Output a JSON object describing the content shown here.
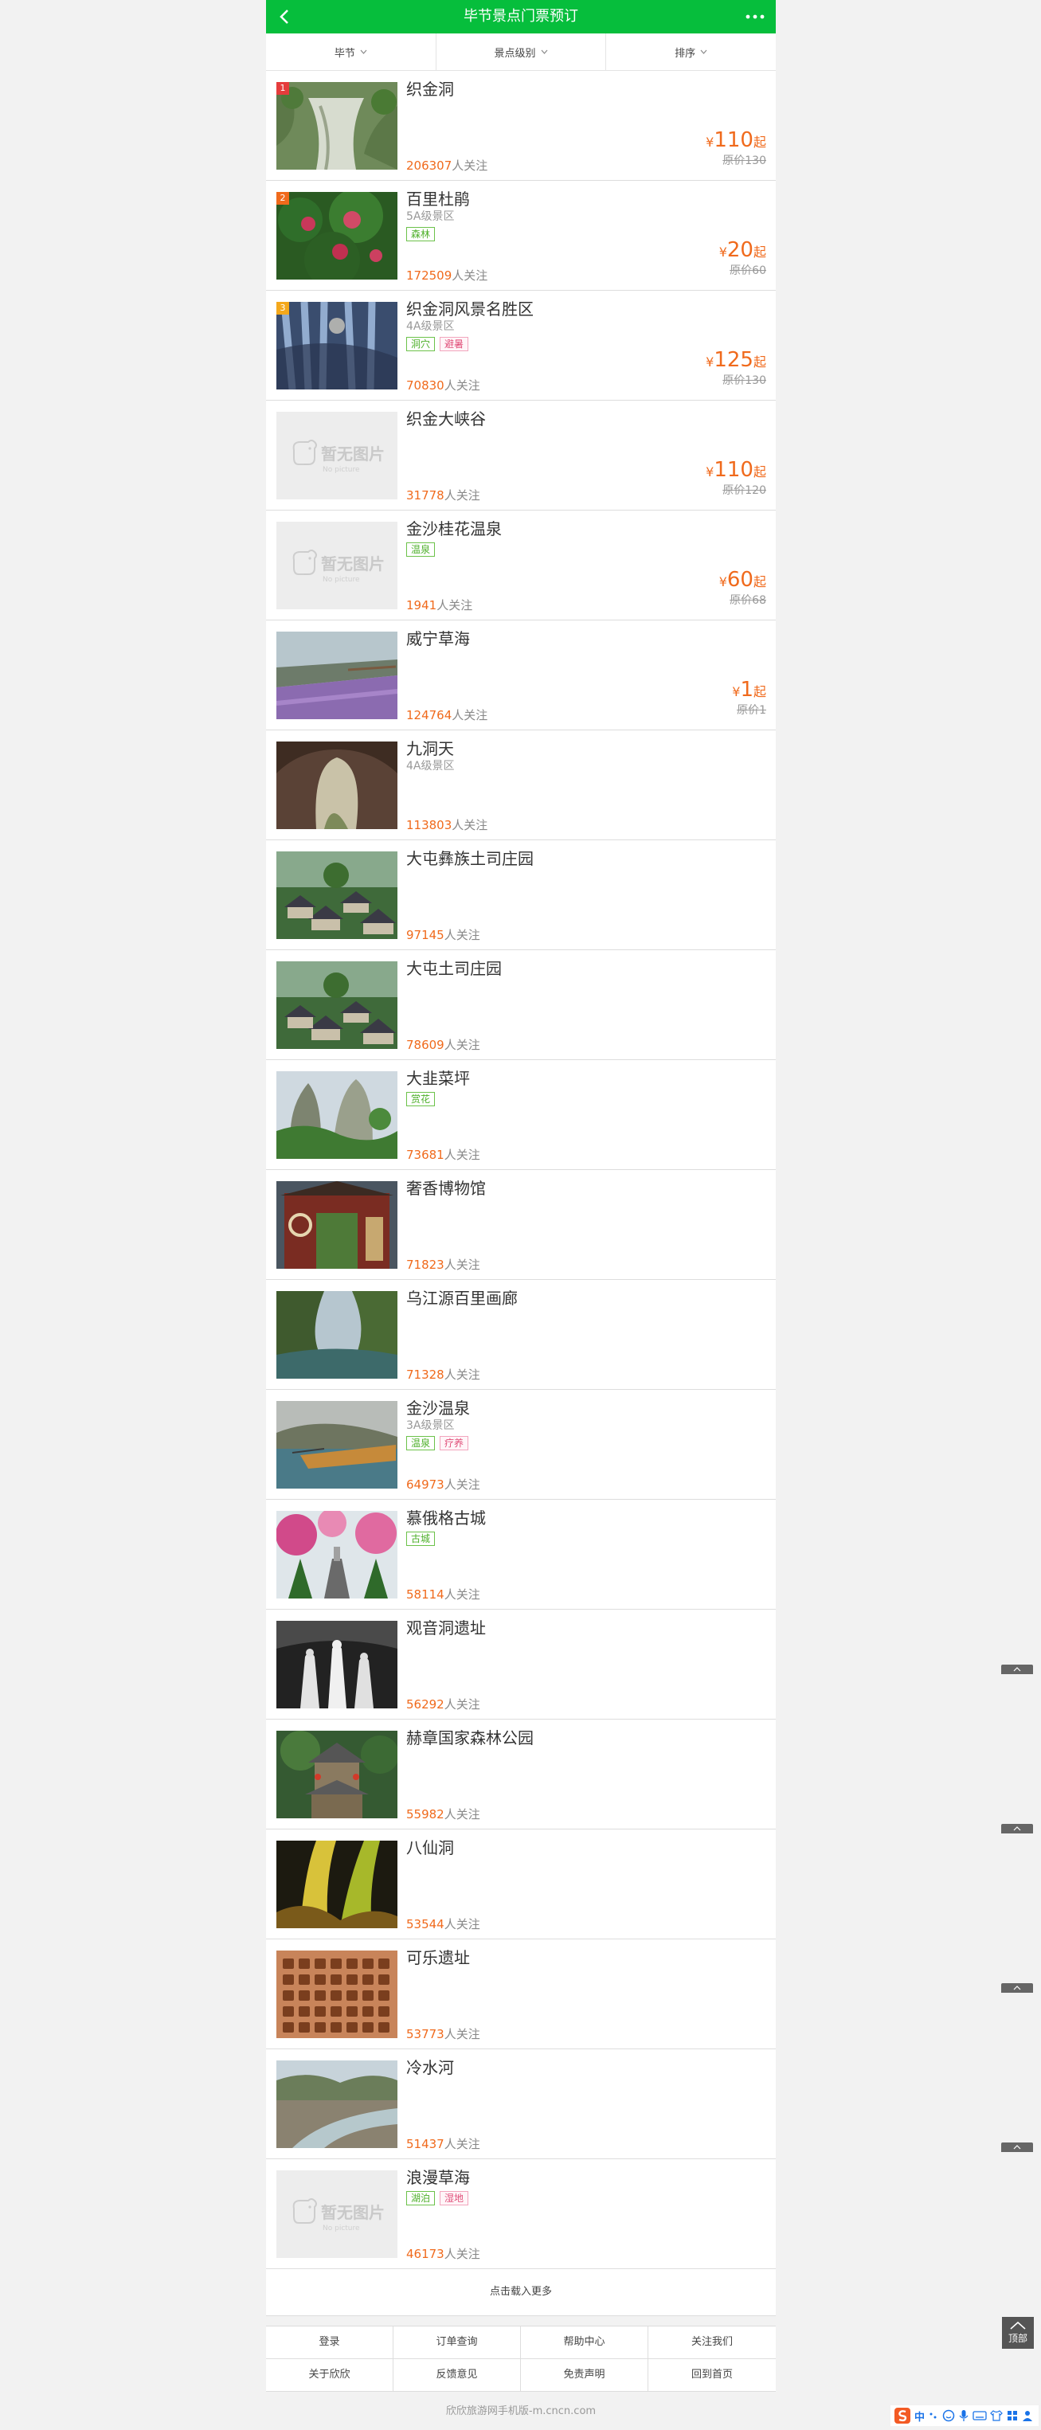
{
  "header": {
    "title": "毕节景点门票预订",
    "back_icon": "back-arrow-icon",
    "more_icon": "more-dots-icon",
    "accent": "#06be3c"
  },
  "filters": [
    {
      "label": "毕节"
    },
    {
      "label": "景点级别"
    },
    {
      "label": "排序"
    }
  ],
  "follow_suffix": "人关注",
  "currency": "¥",
  "price_suffix": "起",
  "orig_prefix": "原价",
  "spots": [
    {
      "rank": "1",
      "rank_color": "#e53c3c",
      "name": "织金洞",
      "level": "",
      "tags": [],
      "followers": "206307",
      "price": "110",
      "orig": "130",
      "img": "cave"
    },
    {
      "rank": "2",
      "rank_color": "#f06a1c",
      "name": "百里杜鹃",
      "level": "5A级景区",
      "tags": [
        {
          "t": "森林",
          "c": "g"
        }
      ],
      "followers": "172509",
      "price": "20",
      "orig": "60",
      "img": "flower"
    },
    {
      "rank": "3",
      "rank_color": "#f4a81c",
      "name": "织金洞风景名胜区",
      "level": "4A级景区",
      "tags": [
        {
          "t": "洞穴",
          "c": "g"
        },
        {
          "t": "避暑",
          "c": "p"
        }
      ],
      "followers": "70830",
      "price": "125",
      "orig": "130",
      "img": "cave2"
    },
    {
      "rank": "",
      "name": "织金大峡谷",
      "level": "",
      "tags": [],
      "followers": "31778",
      "price": "110",
      "orig": "120",
      "img": "none"
    },
    {
      "rank": "",
      "name": "金沙桂花温泉",
      "level": "",
      "tags": [
        {
          "t": "温泉",
          "c": "g"
        }
      ],
      "followers": "1941",
      "price": "60",
      "orig": "68",
      "img": "none"
    },
    {
      "rank": "",
      "name": "威宁草海",
      "level": "",
      "tags": [],
      "followers": "124764",
      "price": "1",
      "orig": "1",
      "img": "lake"
    },
    {
      "rank": "",
      "name": "九洞天",
      "level": "4A级景区",
      "tags": [],
      "followers": "113803",
      "price": "",
      "orig": "",
      "img": "arch"
    },
    {
      "rank": "",
      "name": "大屯彝族土司庄园",
      "level": "",
      "tags": [],
      "followers": "97145",
      "price": "",
      "orig": "",
      "img": "village"
    },
    {
      "rank": "",
      "name": "大屯土司庄园",
      "level": "",
      "tags": [],
      "followers": "78609",
      "price": "",
      "orig": "",
      "img": "village"
    },
    {
      "rank": "",
      "name": "大韭菜坪",
      "level": "",
      "tags": [
        {
          "t": "赏花",
          "c": "g"
        }
      ],
      "followers": "73681",
      "price": "",
      "orig": "",
      "img": "rock"
    },
    {
      "rank": "",
      "name": "奢香博物馆",
      "level": "",
      "tags": [],
      "followers": "71823",
      "price": "",
      "orig": "",
      "img": "gate"
    },
    {
      "rank": "",
      "name": "乌江源百里画廊",
      "level": "",
      "tags": [],
      "followers": "71328",
      "price": "",
      "orig": "",
      "img": "gorge"
    },
    {
      "rank": "",
      "name": "金沙温泉",
      "level": "3A级景区",
      "tags": [
        {
          "t": "温泉",
          "c": "g"
        },
        {
          "t": "疗养",
          "c": "p"
        }
      ],
      "followers": "64973",
      "price": "",
      "orig": "",
      "img": "pool"
    },
    {
      "rank": "",
      "name": "慕俄格古城",
      "level": "",
      "tags": [
        {
          "t": "古城",
          "c": "g"
        }
      ],
      "followers": "58114",
      "price": "",
      "orig": "",
      "img": "blossom"
    },
    {
      "rank": "",
      "name": "观音洞遗址",
      "level": "",
      "tags": [],
      "followers": "56292",
      "price": "",
      "orig": "",
      "img": "statue"
    },
    {
      "rank": "",
      "name": "赫章国家森林公园",
      "level": "",
      "tags": [],
      "followers": "55982",
      "price": "",
      "orig": "",
      "img": "pavilion"
    },
    {
      "rank": "",
      "name": "八仙洞",
      "level": "",
      "tags": [],
      "followers": "53544",
      "price": "",
      "orig": "",
      "img": "karst"
    },
    {
      "rank": "",
      "name": "可乐遗址",
      "level": "",
      "tags": [],
      "followers": "53773",
      "price": "",
      "orig": "",
      "img": "ruins"
    },
    {
      "rank": "",
      "name": "冷水河",
      "level": "",
      "tags": [],
      "followers": "51437",
      "price": "",
      "orig": "",
      "img": "river"
    },
    {
      "rank": "",
      "name": "浪漫草海",
      "level": "",
      "tags": [
        {
          "t": "湖泊",
          "c": "g"
        },
        {
          "t": "湿地",
          "c": "p"
        }
      ],
      "followers": "46173",
      "price": "",
      "orig": "",
      "img": "none"
    }
  ],
  "no_picture": {
    "cn": "暂无图片",
    "en": "No picture"
  },
  "load_more": "点击载入更多",
  "footer_links": [
    "登录",
    "订单查询",
    "帮助中心",
    "关注我们",
    "关于欣欣",
    "反馈意见",
    "免责声明",
    "回到首页"
  ],
  "copyright": "欣欣旅游网手机版-m.cncn.com",
  "to_top": "顶部",
  "ime": {
    "label": "中"
  }
}
